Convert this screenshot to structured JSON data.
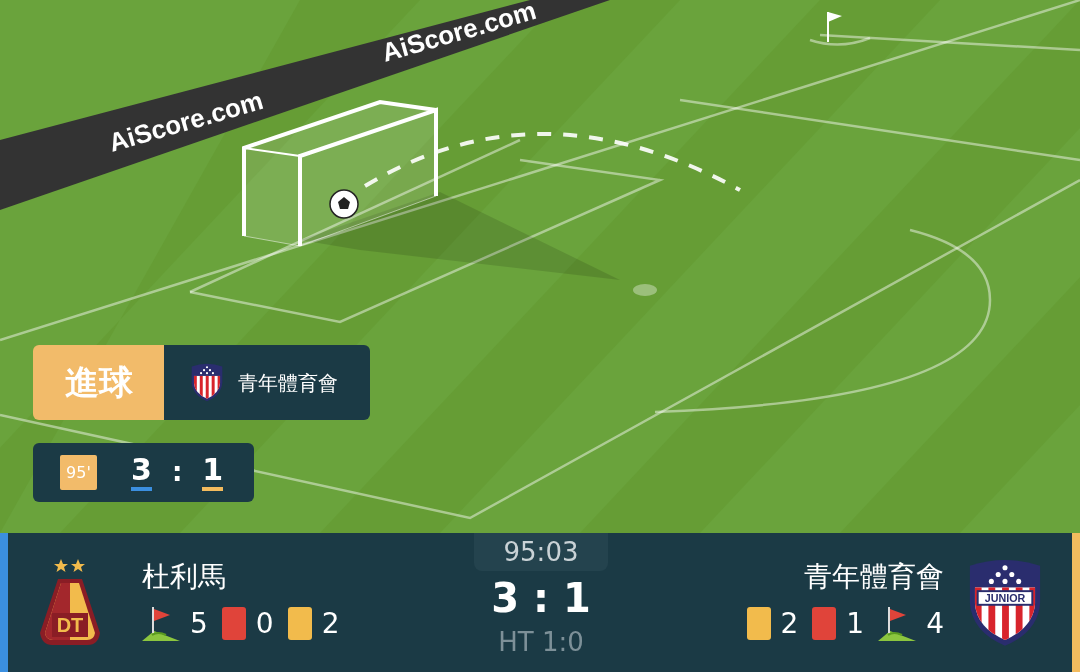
{
  "ad_boards": [
    "AiScore.com",
    "AiScore.com"
  ],
  "goal_event": {
    "label": "進球",
    "team": "青年體育會"
  },
  "event_score": {
    "minute": "95'",
    "home": "3",
    "separator": ":",
    "away": "1"
  },
  "home": {
    "name": "杜利馬",
    "crest_text": "DT",
    "color": "#3b8fe0",
    "stats": [
      {
        "kind": "corner",
        "value": "5"
      },
      {
        "kind": "red",
        "value": "0"
      },
      {
        "kind": "yellow",
        "value": "2"
      }
    ]
  },
  "clock": "95:03",
  "score": "3 : 1",
  "half_time": "HT 1:0",
  "away": {
    "name": "青年體育會",
    "crest_text": "JUNIOR",
    "color": "#f2bb5e",
    "stats": [
      {
        "kind": "yellow",
        "value": "2"
      },
      {
        "kind": "red",
        "value": "1"
      },
      {
        "kind": "corner",
        "value": "4"
      }
    ]
  }
}
